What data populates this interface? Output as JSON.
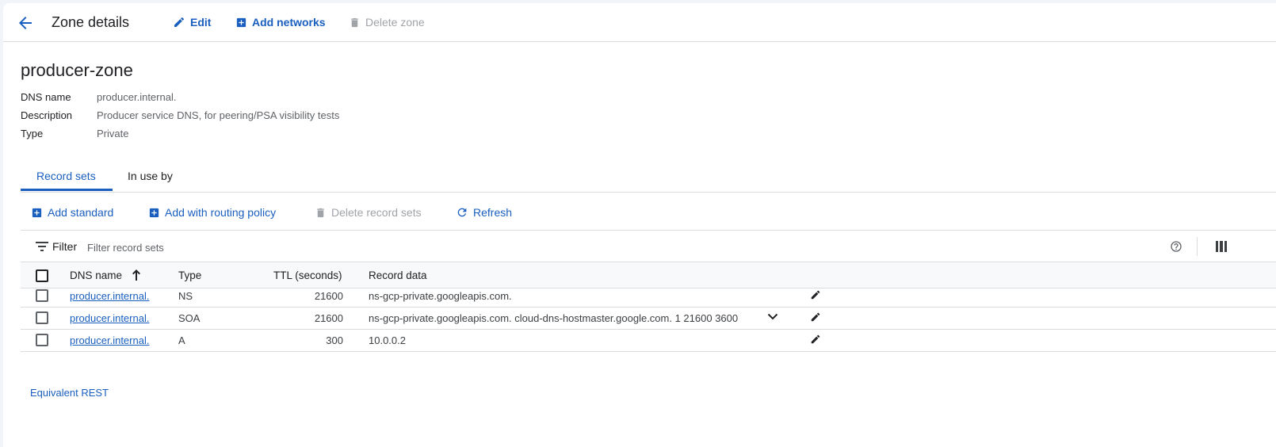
{
  "header": {
    "title": "Zone details",
    "edit_label": "Edit",
    "add_networks_label": "Add networks",
    "delete_zone_label": "Delete zone"
  },
  "zone": {
    "name": "producer-zone",
    "fields": [
      {
        "key": "DNS name",
        "value": "producer.internal."
      },
      {
        "key": "Description",
        "value": "Producer service DNS, for peering/PSA visibility tests"
      },
      {
        "key": "Type",
        "value": "Private"
      }
    ]
  },
  "tabs": [
    {
      "label": "Record sets",
      "active": true
    },
    {
      "label": "In use by",
      "active": false
    }
  ],
  "toolbar": {
    "add_standard": "Add standard",
    "add_routing": "Add with routing policy",
    "delete_records": "Delete record sets",
    "refresh": "Refresh"
  },
  "filter": {
    "label": "Filter",
    "placeholder": "Filter record sets"
  },
  "table": {
    "columns": [
      "DNS name",
      "Type",
      "TTL (seconds)",
      "Record data"
    ],
    "rows": [
      {
        "dns_name": "producer.internal.",
        "type": "NS",
        "ttl": "21600",
        "data": "ns-gcp-private.googleapis.com."
      },
      {
        "dns_name": "producer.internal.",
        "type": "SOA",
        "ttl": "21600",
        "data": "ns-gcp-private.googleapis.com. cloud-dns-hostmaster.google.com. 1 21600 3600"
      },
      {
        "dns_name": "producer.internal.",
        "type": "A",
        "ttl": "300",
        "data": "10.0.0.2"
      }
    ]
  },
  "footer": {
    "rest_link": "Equivalent REST"
  },
  "colors": {
    "accent": "#1a5fbf",
    "disabled": "#a0a3a8",
    "border": "#dadce0"
  }
}
